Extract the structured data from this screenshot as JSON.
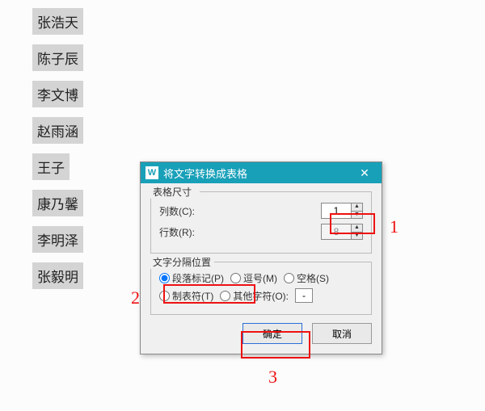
{
  "document": {
    "names": [
      "张浩天",
      "陈子辰",
      "李文博",
      "赵雨涵",
      "王子",
      "康乃馨",
      "李明泽",
      "张毅明"
    ]
  },
  "dialog": {
    "title": "将文字转换成表格",
    "section_size": "表格尺寸",
    "columns_label": "列数(C):",
    "columns_value": "1",
    "rows_label": "行数(R):",
    "rows_value": "8",
    "section_sep": "文字分隔位置",
    "sep_paragraph": "段落标记(P)",
    "sep_comma": "逗号(M)",
    "sep_space": "空格(S)",
    "sep_tab": "制表符(T)",
    "sep_other": "其他字符(O):",
    "sep_other_value": "-",
    "ok": "确定",
    "cancel": "取消"
  },
  "annotations": {
    "a1": "1",
    "a2": "2",
    "a3": "3"
  }
}
